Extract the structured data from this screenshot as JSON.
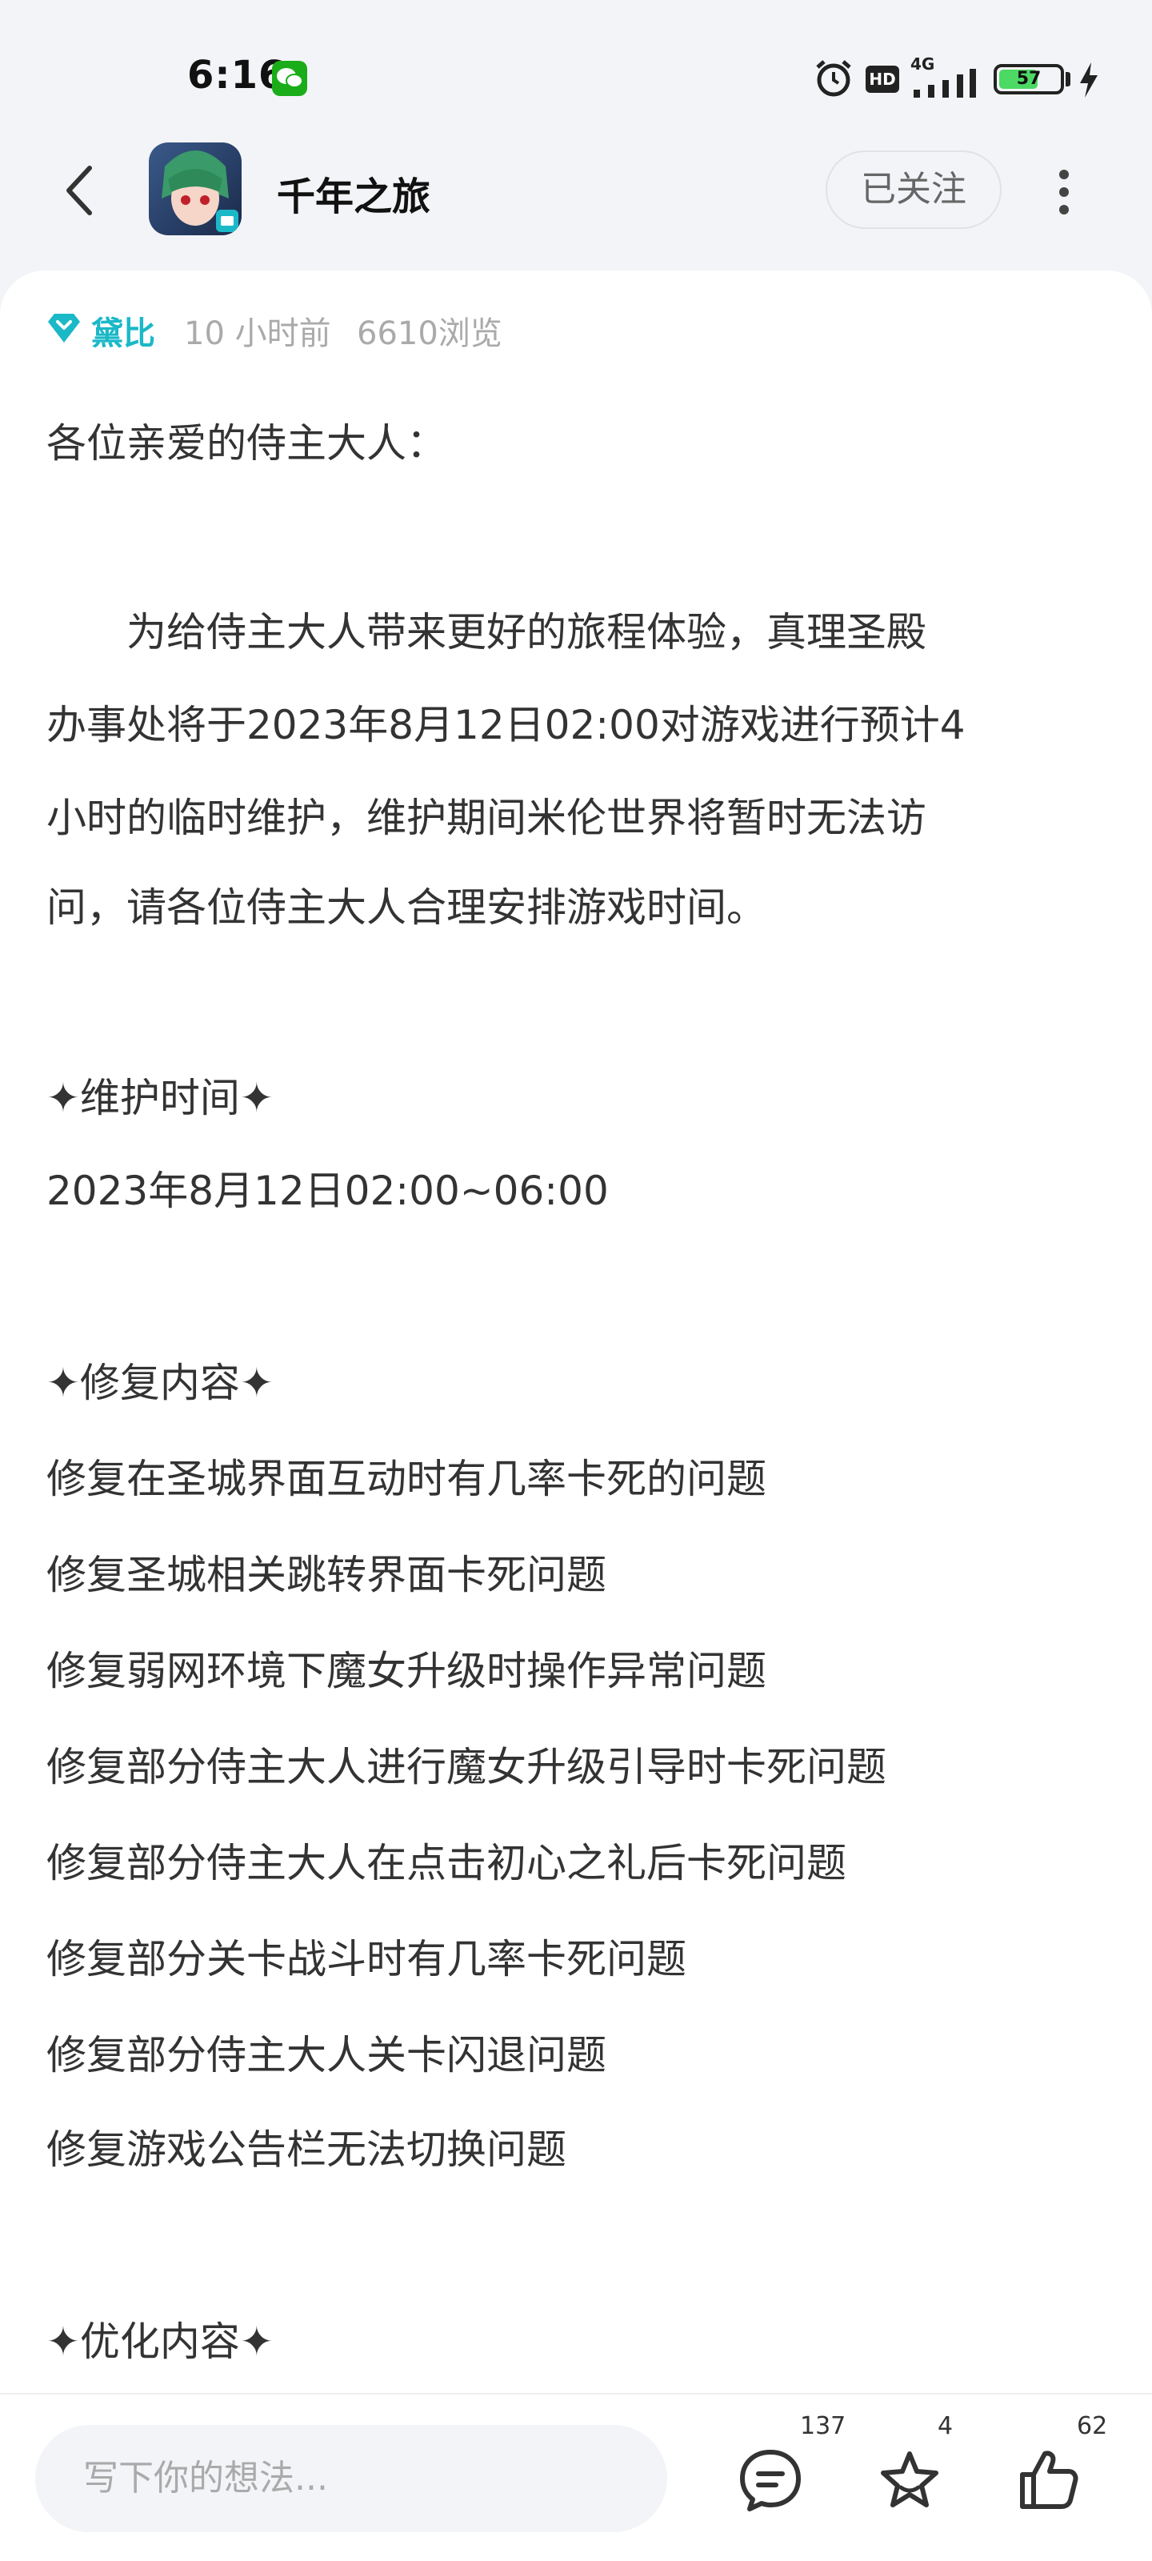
{
  "status_bar": {
    "time": "6:16",
    "network": "4G",
    "hd": "HD",
    "battery": "57"
  },
  "header": {
    "title": "千年之旅",
    "follow_label": "已关注"
  },
  "post": {
    "author": "黛比",
    "time_ago": "10 小时前",
    "views": "6610浏览",
    "lines": [
      "各位亲爱的侍主大人：",
      "　　为给侍主大人带来更好的旅程体验，真理圣殿",
      "办事处将于2023年8月12日02:00对游戏进行预计4",
      "小时的临时维护，维护期间米伦世界将暂时无法访",
      "问，请各位侍主大人合理安排游戏时间。",
      "✦维护时间✦",
      "2023年8月12日02:00~06:00",
      "✦修复内容✦",
      "修复在圣城界面互动时有几率卡死的问题",
      "修复圣城相关跳转界面卡死问题",
      "修复弱网环境下魔女升级时操作异常问题",
      "修复部分侍主大人进行魔女升级引导时卡死问题",
      "修复部分侍主大人在点击初心之礼后卡死问题",
      "修复部分关卡战斗时有几率卡死问题",
      "修复部分侍主大人关卡闪退问题",
      "修复游戏公告栏无法切换问题",
      "✦优化内容✦"
    ]
  },
  "bottom_bar": {
    "comment_placeholder": "写下你的想法...",
    "comment_count": "137",
    "star_count": "4",
    "like_count": "62"
  },
  "colors": {
    "accent": "#1bb8c8",
    "background": "#f3f4f7"
  }
}
